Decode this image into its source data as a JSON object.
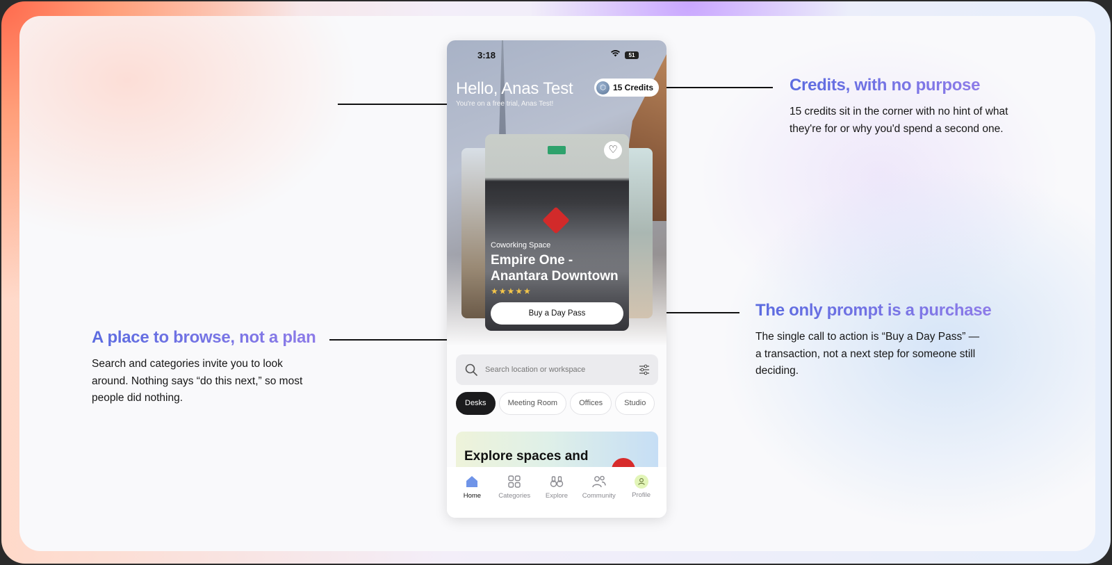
{
  "colors": {
    "accent_gradient_start": "#5b6be0",
    "accent_gradient_end": "#8d7be8",
    "active_chip": "#1b1b1d",
    "stars": "#f4c64a",
    "promo_ball": "#d72b2b"
  },
  "annotations": {
    "credits": {
      "title": "Credits, with no purpose",
      "body": "15 credits sit in the corner with no hint of what they're for or why you'd spend a second one."
    },
    "purchase": {
      "title": "The only prompt is a purchase",
      "body": "The single call to action is “Buy a Day Pass” — a transaction, not a next step for someone still deciding."
    },
    "browse": {
      "title": "A place to browse, not a plan",
      "body": "Search and categories invite you to look around. Nothing says “do this next,” so most people did nothing."
    }
  },
  "phone": {
    "status": {
      "time": "3:18",
      "battery": "51",
      "wifi_icon": "wifi-icon"
    },
    "greeting": "Hello, Anas Test",
    "subgreeting": "You're on a free trial, Anas Test!",
    "credits_label": "15 Credits",
    "featured": {
      "category": "Coworking Space",
      "name": "Empire One - Anantara Downtown",
      "stars": "★★★★★",
      "cta": "Buy a Day Pass",
      "rating": 5
    },
    "search": {
      "placeholder": "Search location or workspace"
    },
    "chips": [
      {
        "label": "Desks",
        "active": true
      },
      {
        "label": "Meeting Room",
        "active": false
      },
      {
        "label": "Offices",
        "active": false
      },
      {
        "label": "Studio",
        "active": false
      }
    ],
    "promo_title": "Explore spaces and",
    "tabs": [
      {
        "label": "Home",
        "icon": "home-icon",
        "active": true
      },
      {
        "label": "Categories",
        "icon": "grid-icon",
        "active": false
      },
      {
        "label": "Explore",
        "icon": "binoculars-icon",
        "active": false
      },
      {
        "label": "Community",
        "icon": "people-icon",
        "active": false
      },
      {
        "label": "Profile",
        "icon": "avatar-icon",
        "active": false
      }
    ]
  }
}
